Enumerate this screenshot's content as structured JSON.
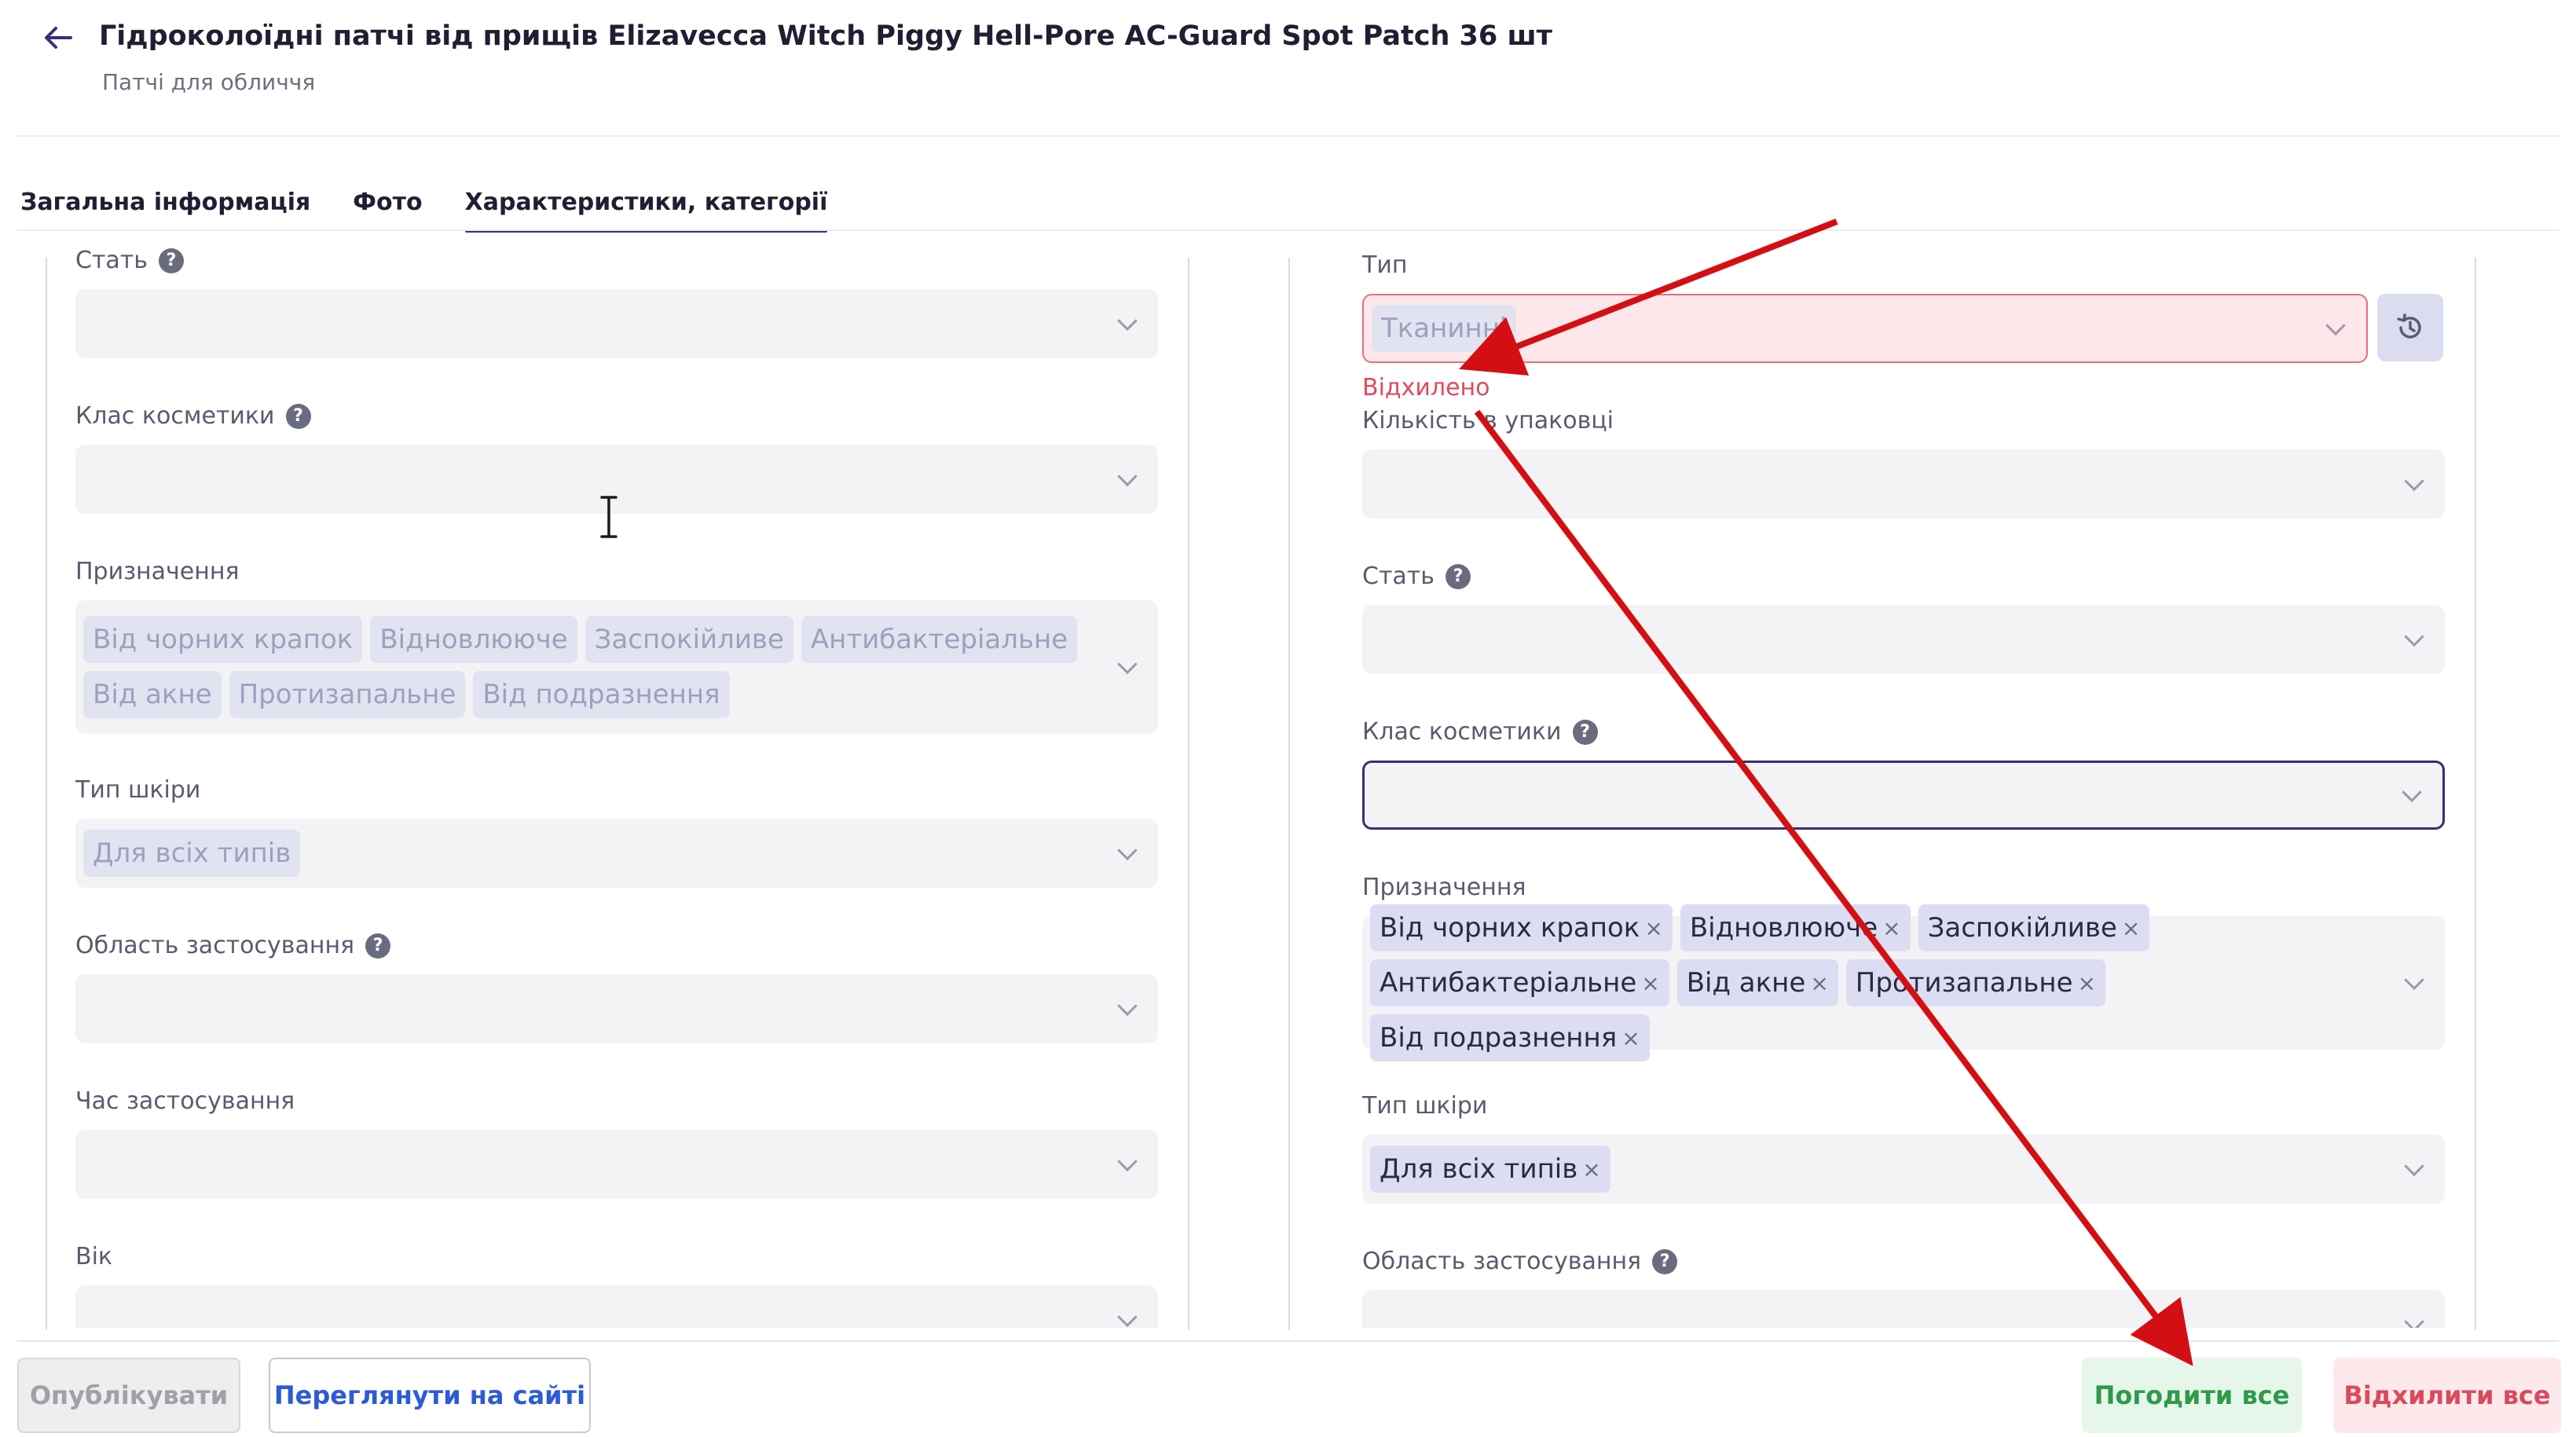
{
  "header": {
    "title": "Гідроколоїдні патчі від прищів Elizavecca Witch Piggy Hell-Pore AC-Guard Spot Patch 36 шт",
    "subtitle": "Патчі для обличчя",
    "back_icon": "arrow-left-icon"
  },
  "tabs": [
    {
      "label": "Загальна інформація",
      "active": false
    },
    {
      "label": "Фото",
      "active": false
    },
    {
      "label": "Характеристики, категорії",
      "active": true
    }
  ],
  "left_column": {
    "gender": {
      "label": "Стать",
      "value": ""
    },
    "cosmetic_class": {
      "label": "Клас косметики",
      "value": ""
    },
    "purpose": {
      "label": "Призначення",
      "chips": [
        "Від чорних крапок",
        "Відновлююче",
        "Заспокійливе",
        "Антибактеріальне",
        "Від акне",
        "Протизапальне",
        "Від подразнення"
      ]
    },
    "skin_type": {
      "label": "Тип шкіри",
      "chips": [
        "Для всіх типів"
      ]
    },
    "application_area": {
      "label": "Область застосування",
      "value": ""
    },
    "application_time": {
      "label": "Час застосування",
      "value": ""
    },
    "age": {
      "label": "Вік",
      "value": ""
    }
  },
  "right_column": {
    "type": {
      "label": "Тип",
      "chips": [
        "Тканинні"
      ],
      "status": "Відхилено"
    },
    "quantity_in_package": {
      "label": "Кількість в упаковці",
      "value": ""
    },
    "gender": {
      "label": "Стать",
      "value": ""
    },
    "cosmetic_class": {
      "label": "Клас косметики",
      "value": ""
    },
    "purpose": {
      "label": "Призначення",
      "chips": [
        "Від чорних крапок",
        "Відновлююче",
        "Заспокійливе",
        "Антибактеріальне",
        "Від акне",
        "Протизапальне",
        "Від подразнення"
      ]
    },
    "skin_type": {
      "label": "Тип шкіри",
      "chips": [
        "Для всіх типів"
      ]
    },
    "application_area": {
      "label": "Область застосування",
      "value": ""
    }
  },
  "footer": {
    "publish": "Опублікувати",
    "view_on_site": "Переглянути на сайті",
    "approve_all": "Погодити все",
    "reject_all": "Відхилити все"
  },
  "colors": {
    "accent": "#3c2c7a",
    "error": "#e04a5c",
    "approve": "#2e9a4a",
    "link": "#2c5bd6",
    "annotation_arrow": "#d40f14"
  }
}
